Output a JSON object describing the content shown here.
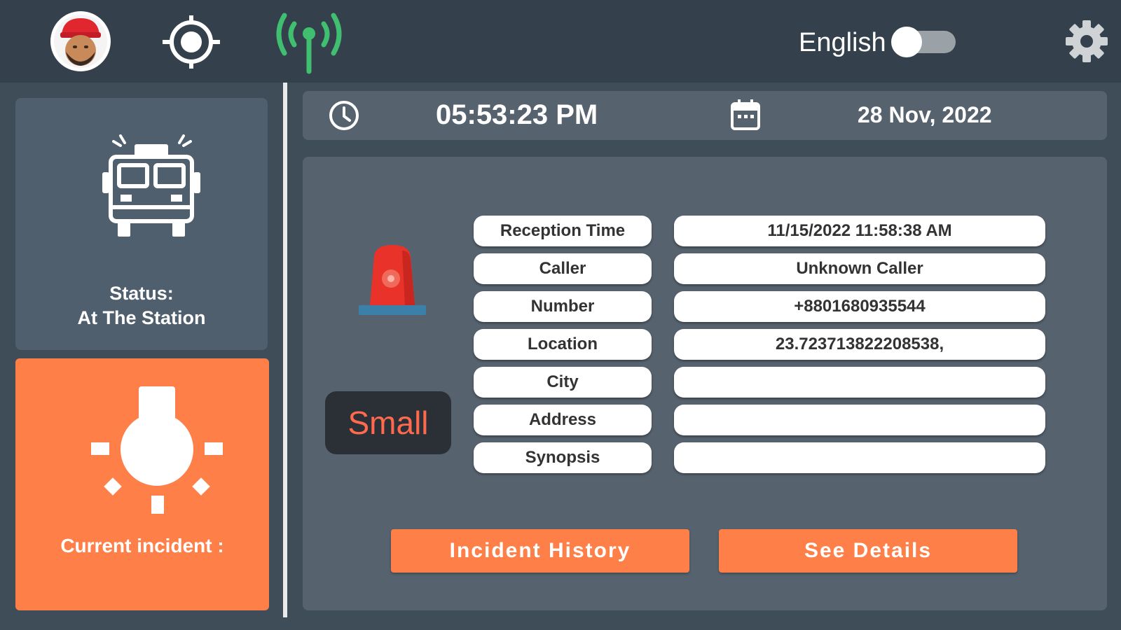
{
  "header": {
    "language_label": "English",
    "language_toggle_on": false,
    "icons": [
      "avatar",
      "target-icon",
      "signal-icon",
      "gear-icon"
    ],
    "signal_color": "#3fbf6f"
  },
  "sidebar": {
    "status_line1": "Status:",
    "status_line2": "At The Station",
    "incident_label": "Current incident :",
    "incident_color": "#ff7f48"
  },
  "timebar": {
    "time": "05:53:23 PM",
    "date": "28 Nov, 2022"
  },
  "incident": {
    "severity": "Small",
    "severity_color": "#ff6a4e",
    "fields": [
      {
        "label": "Reception Time",
        "value": "11/15/2022 11:58:38 AM"
      },
      {
        "label": "Caller",
        "value": "Unknown Caller"
      },
      {
        "label": "Number",
        "value": "+8801680935544"
      },
      {
        "label": "Location",
        "value": "23.723713822208538,"
      },
      {
        "label": "City",
        "value": ""
      },
      {
        "label": "Address",
        "value": ""
      },
      {
        "label": "Synopsis",
        "value": ""
      }
    ]
  },
  "actions": {
    "history_label": "Incident History",
    "details_label": "See Details"
  }
}
